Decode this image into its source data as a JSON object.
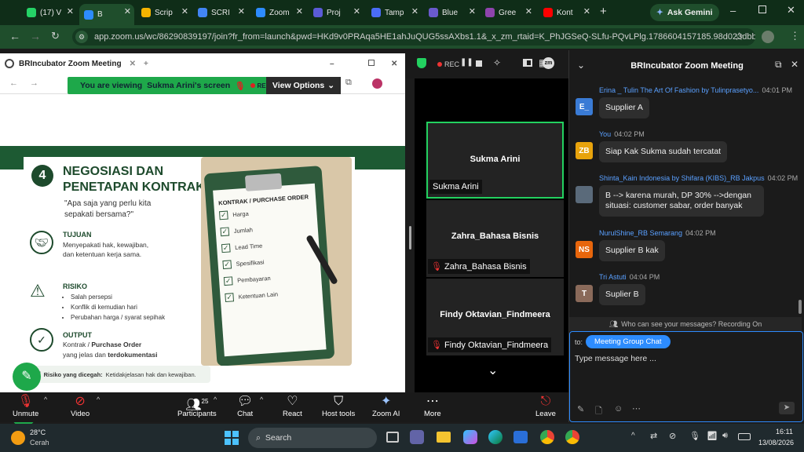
{
  "tabs": [
    {
      "label": "(17) V",
      "color": "#25d366",
      "badge": "17"
    },
    {
      "label": "B",
      "color": "#2d8cff",
      "active": true
    },
    {
      "label": "Scrip",
      "color": "#f4b400"
    },
    {
      "label": "SCRI",
      "color": "#4285f4"
    },
    {
      "label": "Zoom",
      "color": "#2d8cff"
    },
    {
      "label": "Proj",
      "color": "#5b5bd6"
    },
    {
      "label": "Tamp",
      "color": "#4a6cf7"
    },
    {
      "label": "Blue",
      "color": "#6a5acd"
    },
    {
      "label": "Gree",
      "color": "#8e44ad"
    },
    {
      "label": "Kont",
      "color": "#ff0000"
    }
  ],
  "browser": {
    "url": "app.zoom.us/wc/86290839197/join?fr_from=launch&pwd=HKd9v0PRAqa5HE1ahJuQUG5ssAXbs1.1&_x_zm_rtaid=K_PhJGSeQ-SLfu-PQvLPlg.1786604157185.98d023dbb4b...",
    "ask_gemini": "Ask Gemini"
  },
  "zoom": {
    "rec_label": "REC",
    "share_window_title": "BRIncubator Zoom Meeting",
    "viewing_text": "You are viewing",
    "presenter_screen": "Sukma Arini's screen",
    "rec_small": "REC",
    "view_options": "View Options"
  },
  "slide": {
    "number": "4",
    "title_line1": "NEGOSIASI DAN",
    "title_line2": "PENETAPAN KONTRAK",
    "question": "\"Apa saja yang perlu kita sepakati bersama?\"",
    "tujuan_heading": "TUJUAN",
    "tujuan_text": "Menyepakati hak, kewajiban, dan ketentuan kerja sama.",
    "risiko_heading": "RISIKO",
    "risiko_items": [
      "Salah persepsi",
      "Konflik di kemudian hari",
      "Perubahan harga / syarat sepihak"
    ],
    "output_heading": "OUTPUT",
    "output_text_1": "Kontrak / ",
    "output_bold": "Purchase Order",
    "output_text_2": "yang jelas dan ",
    "output_bold_2": "terdokumentasi",
    "risk_footer_bold": "Risiko yang dicegah:",
    "risk_footer_text": "Ketidakjelasan hak dan kewajiban.",
    "clipboard_title": "KONTRAK / PURCHASE ORDER",
    "clipboard_items": [
      "Harga",
      "Jumlah",
      "Lead Time",
      "Spesifikasi",
      "Pembayaran",
      "Ketentuan Lain"
    ]
  },
  "gallery": [
    {
      "name": "Sukma Arini",
      "label": "Sukma Arini",
      "muted": false,
      "active": true
    },
    {
      "name": "Zahra_Bahasa Bisnis",
      "label": "Zahra_Bahasa Bisnis",
      "muted": true,
      "active": false
    },
    {
      "name": "Findy Oktavian_Findmeera",
      "label": "Findy Oktavian_Findmeera",
      "muted": true,
      "active": false
    }
  ],
  "chat": {
    "title": "BRIncubator Zoom Meeting",
    "messages": [
      {
        "sender": "Erina _ Tulin The Art Of Fashion by Tulinprasetyo...",
        "time": "04:01 PM",
        "avatar": "E_",
        "avatar_color": "#3a7bd5",
        "text": "Supplier A"
      },
      {
        "sender": "You",
        "time": "04:02 PM",
        "avatar": "ZB",
        "avatar_color": "#e8a30c",
        "text": "Siap Kak Sukma sudah tercatat"
      },
      {
        "sender": "Shinta_Kain Indonesia by Shifara (KIBS)_RB Jakpus",
        "time": "04:02 PM",
        "avatar": "",
        "avatar_color": "#5a6a7a",
        "text": "B --> karena murah, DP 30% -->dengan situasi:  customer sabar, order banyak"
      },
      {
        "sender": "NurulShine_RB Semarang",
        "time": "04:02 PM",
        "avatar": "NS",
        "avatar_color": "#e8660c",
        "text": "Supplier B kak"
      },
      {
        "sender": "Tri Astuti",
        "time": "04:04 PM",
        "avatar": "T",
        "avatar_color": "#8a6a5a",
        "text": "Suplier B"
      }
    ],
    "privacy": "Who can see your messages? Recording On",
    "to_label": "to:",
    "recipient": "Meeting Group Chat",
    "placeholder": "Type message here ..."
  },
  "controls": {
    "unmute": "Unmute",
    "video": "Video",
    "participants": "Participants",
    "participants_count": "25",
    "chat": "Chat",
    "react": "React",
    "host_tools": "Host tools",
    "zoom_ai": "Zoom AI",
    "more": "More",
    "leave": "Leave"
  },
  "taskbar": {
    "weather_temp": "28°C",
    "weather_desc": "Cerah",
    "search": "Search",
    "time": "16:11",
    "date": "13/08/2026"
  }
}
